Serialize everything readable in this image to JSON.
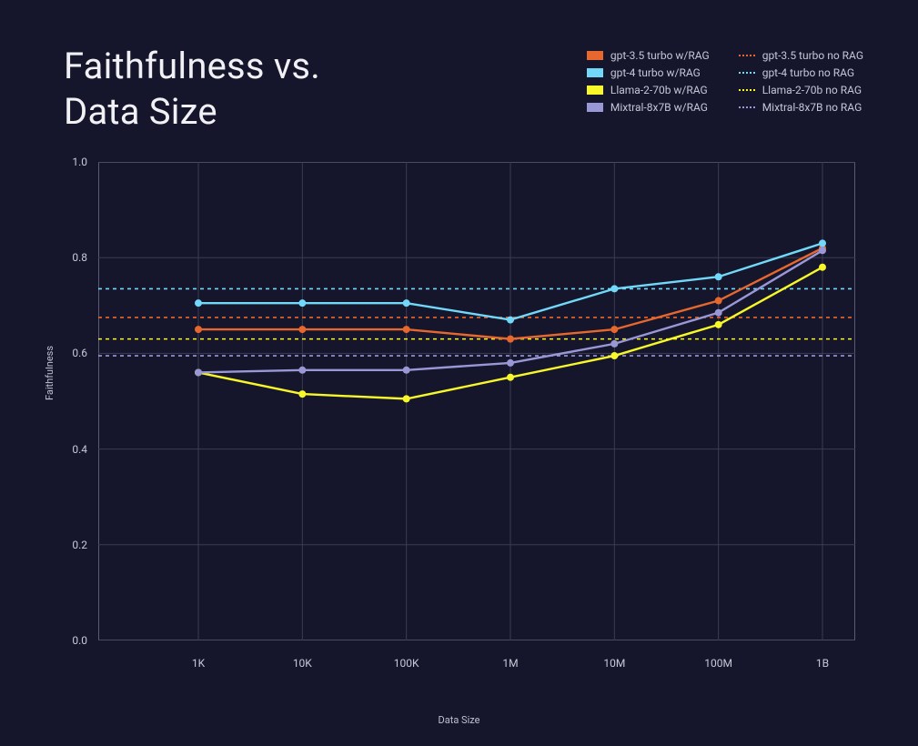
{
  "title_line1": "Faithfulness vs.",
  "title_line2": "Data Size",
  "ylabel": "Faithfulness",
  "xlabel": "Data Size",
  "legend_col1": [
    {
      "label": "gpt-3.5 turbo w/RAG",
      "color": "#e6682e"
    },
    {
      "label": "gpt-4 turbo w/RAG",
      "color": "#72d8f9"
    },
    {
      "label": "Llama-2-70b w/RAG",
      "color": "#f7f729"
    },
    {
      "label": "Mixtral-8x7B w/RAG",
      "color": "#9a97d6"
    }
  ],
  "legend_col2": [
    {
      "label": "gpt-3.5 turbo no RAG",
      "color": "#e6682e"
    },
    {
      "label": "gpt-4 turbo no RAG",
      "color": "#72d8f9"
    },
    {
      "label": "Llama-2-70b no RAG",
      "color": "#f7f729"
    },
    {
      "label": "Mixtral-8x7B no RAG",
      "color": "#9a97d6"
    }
  ],
  "chart_data": {
    "type": "line",
    "xlabel": "Data Size",
    "ylabel": "Faithfulness",
    "title": "Faithfulness vs. Data Size",
    "categories": [
      "1K",
      "10K",
      "100K",
      "1M",
      "10M",
      "100M",
      "1B"
    ],
    "ylim": [
      0.0,
      1.0
    ],
    "y_ticks": [
      0.0,
      0.2,
      0.4,
      0.6,
      0.8,
      1.0
    ],
    "series": [
      {
        "name": "gpt-3.5 turbo w/RAG",
        "color": "#e6682e",
        "style": "solid",
        "values": [
          0.65,
          0.65,
          0.65,
          0.63,
          0.65,
          0.71,
          0.82
        ]
      },
      {
        "name": "gpt-4 turbo w/RAG",
        "color": "#72d8f9",
        "style": "solid",
        "values": [
          0.705,
          0.705,
          0.705,
          0.67,
          0.735,
          0.76,
          0.83
        ]
      },
      {
        "name": "Llama-2-70b w/RAG",
        "color": "#f7f729",
        "style": "solid",
        "values": [
          0.56,
          0.515,
          0.505,
          0.55,
          0.595,
          0.66,
          0.78
        ]
      },
      {
        "name": "Mixtral-8x7B w/RAG",
        "color": "#9a97d6",
        "style": "solid",
        "values": [
          0.56,
          0.565,
          0.565,
          0.58,
          0.62,
          0.685,
          0.815
        ]
      },
      {
        "name": "gpt-3.5 turbo no RAG",
        "color": "#e6682e",
        "style": "dashed",
        "constant": 0.675
      },
      {
        "name": "gpt-4 turbo no RAG",
        "color": "#72d8f9",
        "style": "dashed",
        "constant": 0.735
      },
      {
        "name": "Llama-2-70b no RAG",
        "color": "#f7f729",
        "style": "dashed",
        "constant": 0.63
      },
      {
        "name": "Mixtral-8x7B no RAG",
        "color": "#9a97d6",
        "style": "dashed",
        "constant": 0.595
      }
    ]
  }
}
